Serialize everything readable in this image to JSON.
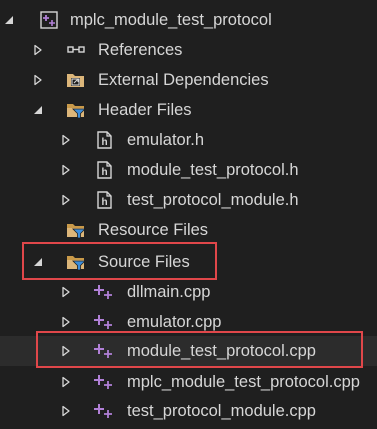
{
  "tree": {
    "project": {
      "label": "mplc_module_test_protocol",
      "icon": "cpp-project-icon"
    },
    "references": {
      "label": "References",
      "icon": "references-icon"
    },
    "external_dependencies": {
      "label": "External Dependencies",
      "icon": "external-dependencies-icon"
    },
    "header_files": {
      "label": "Header Files",
      "icon": "filter-folder-icon",
      "children": [
        {
          "label": "emulator.h",
          "icon": "header-file-icon"
        },
        {
          "label": "module_test_protocol.h",
          "icon": "header-file-icon"
        },
        {
          "label": "test_protocol_module.h",
          "icon": "header-file-icon"
        }
      ]
    },
    "resource_files": {
      "label": "Resource Files",
      "icon": "filter-folder-icon"
    },
    "source_files": {
      "label": "Source Files",
      "icon": "filter-folder-icon",
      "children": [
        {
          "label": "dllmain.cpp",
          "icon": "cpp-file-icon"
        },
        {
          "label": "emulator.cpp",
          "icon": "cpp-file-icon"
        },
        {
          "label": "module_test_protocol.cpp",
          "icon": "cpp-file-icon"
        },
        {
          "label": "mplc_module_test_protocol.cpp",
          "icon": "cpp-file-icon"
        },
        {
          "label": "test_protocol_module.cpp",
          "icon": "cpp-file-icon"
        }
      ]
    }
  },
  "colors": {
    "background": "#1f1f1f",
    "text": "#d6d6d6",
    "highlight_border": "#e0474a",
    "cpp_purple": "#b180d7",
    "folder": "#dcb67a",
    "filter_blue": "#3c8ddb"
  }
}
